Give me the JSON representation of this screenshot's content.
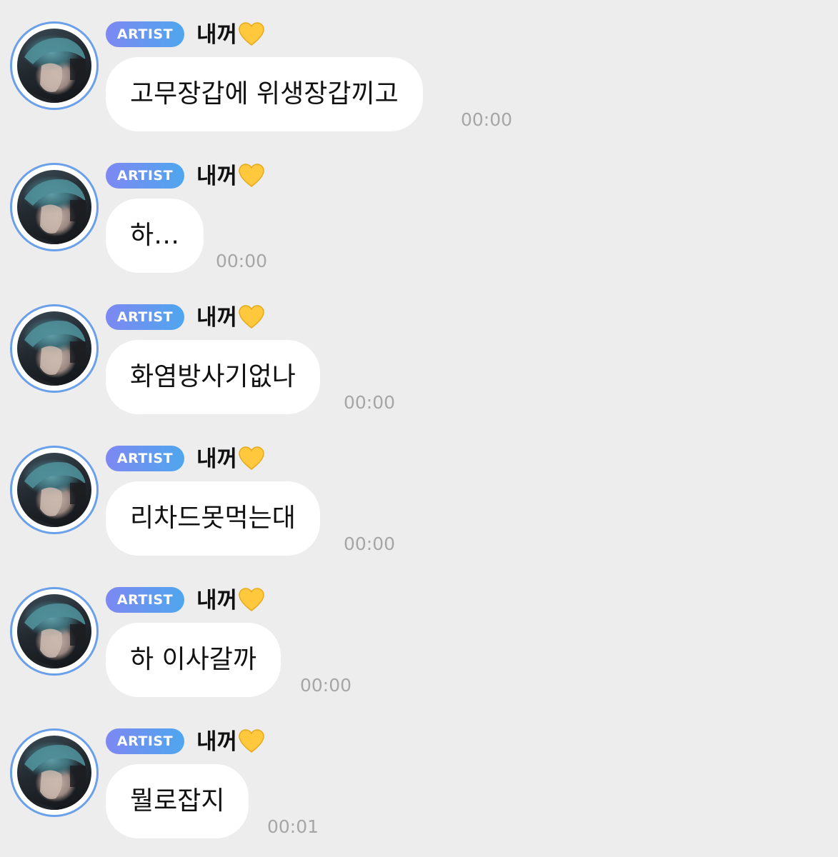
{
  "messages": [
    {
      "badge": "ARTIST",
      "sender": "내꺼",
      "sender_emoji": "yellow-heart-icon",
      "text": "고무장갑에 위생장갑끼고",
      "time": "00:00"
    },
    {
      "badge": "ARTIST",
      "sender": "내꺼",
      "sender_emoji": "yellow-heart-icon",
      "text": "하…",
      "time": "00:00"
    },
    {
      "badge": "ARTIST",
      "sender": "내꺼",
      "sender_emoji": "yellow-heart-icon",
      "text": "화염방사기없나",
      "time": "00:00"
    },
    {
      "badge": "ARTIST",
      "sender": "내꺼",
      "sender_emoji": "yellow-heart-icon",
      "text": "리차드못먹는대",
      "time": "00:00"
    },
    {
      "badge": "ARTIST",
      "sender": "내꺼",
      "sender_emoji": "yellow-heart-icon",
      "text": "하 이사갈까",
      "time": "00:00"
    },
    {
      "badge": "ARTIST",
      "sender": "내꺼",
      "sender_emoji": "yellow-heart-icon",
      "text": "뭘로잡지",
      "time": "00:01"
    }
  ],
  "colors": {
    "background": "#ededed",
    "bubble": "#ffffff",
    "badge_gradient_start": "#7d88f2",
    "badge_gradient_end": "#4fa6ee",
    "avatar_ring": "#6aa0ea",
    "heart": "#ffc83d",
    "timestamp": "#a6a6a6"
  }
}
